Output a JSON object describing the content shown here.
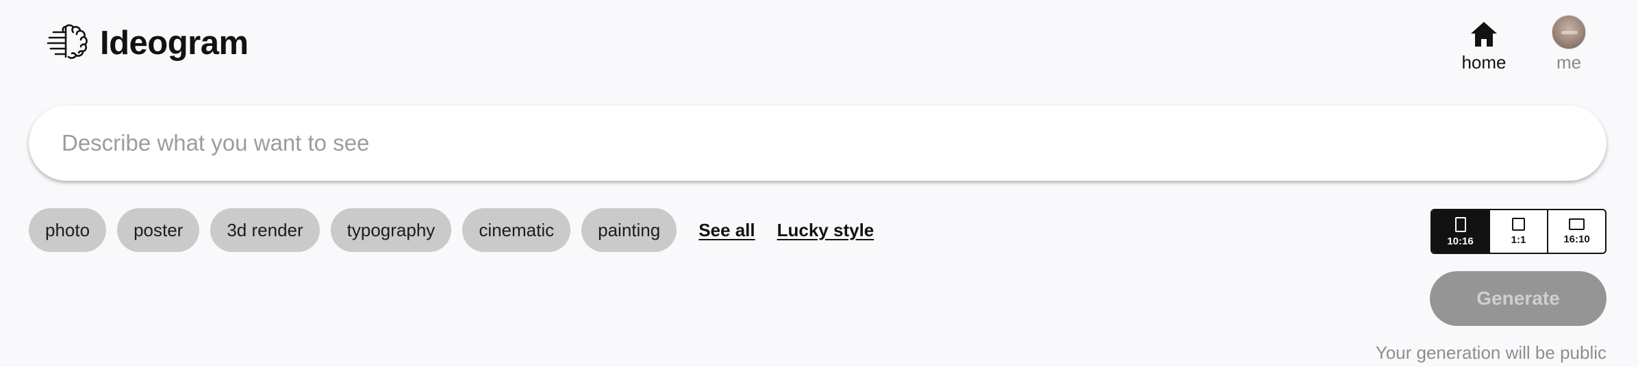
{
  "brand": {
    "name": "Ideogram",
    "logo_icon": "brain-icon"
  },
  "nav": {
    "home": {
      "label": "home",
      "icon": "home-icon"
    },
    "me": {
      "label": "me",
      "icon": "avatar"
    }
  },
  "prompt": {
    "placeholder": "Describe what you want to see",
    "value": ""
  },
  "styles": {
    "chips": [
      {
        "label": "photo"
      },
      {
        "label": "poster"
      },
      {
        "label": "3d render"
      },
      {
        "label": "typography"
      },
      {
        "label": "cinematic"
      },
      {
        "label": "painting"
      }
    ],
    "see_all": "See all",
    "lucky_style": "Lucky style"
  },
  "aspect_ratio": {
    "selected": "10:16",
    "options": [
      {
        "label": "10:16",
        "shape": "portrait"
      },
      {
        "label": "1:1",
        "shape": "square"
      },
      {
        "label": "16:10",
        "shape": "landscape"
      }
    ]
  },
  "generate": {
    "label": "Generate",
    "enabled": false
  },
  "visibility_note": "Your generation will be public",
  "colors": {
    "background": "#f9f9fb",
    "text": "#121212",
    "chip": "#cacaca",
    "generate_disabled": "#959595",
    "muted": "#8e8e8e"
  }
}
